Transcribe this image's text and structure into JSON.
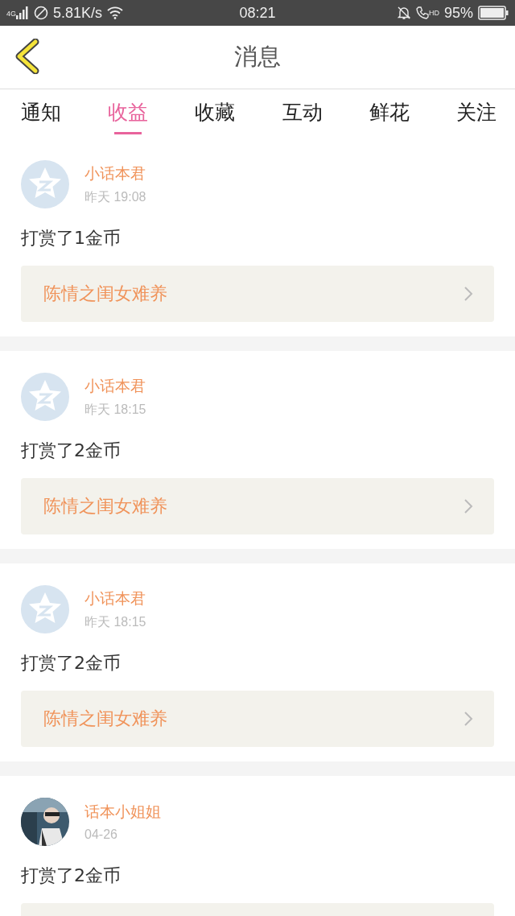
{
  "status_bar": {
    "network": "4G",
    "speed": "5.81K/s",
    "time": "08:21",
    "call_badge": "HD",
    "battery": "95%"
  },
  "header": {
    "title": "消息"
  },
  "tabs": [
    {
      "label": "通知",
      "selected": false
    },
    {
      "label": "收益",
      "selected": true
    },
    {
      "label": "收藏",
      "selected": false
    },
    {
      "label": "互动",
      "selected": false
    },
    {
      "label": "鲜花",
      "selected": false
    },
    {
      "label": "关注",
      "selected": false
    }
  ],
  "messages": [
    {
      "avatar": {
        "kind": "default"
      },
      "name": "小话本君",
      "time": "昨天 19:08",
      "text": "打赏了1金币",
      "book": "陈情之闺女难养"
    },
    {
      "avatar": {
        "kind": "default"
      },
      "name": "小话本君",
      "time": "昨天 18:15",
      "text": "打赏了2金币",
      "book": "陈情之闺女难养"
    },
    {
      "avatar": {
        "kind": "default"
      },
      "name": "小话本君",
      "time": "昨天 18:15",
      "text": "打赏了2金币",
      "book": "陈情之闺女难养"
    },
    {
      "name": "话本小姐姐",
      "time": "04-26",
      "text": "打赏了2金币"
    }
  ]
}
